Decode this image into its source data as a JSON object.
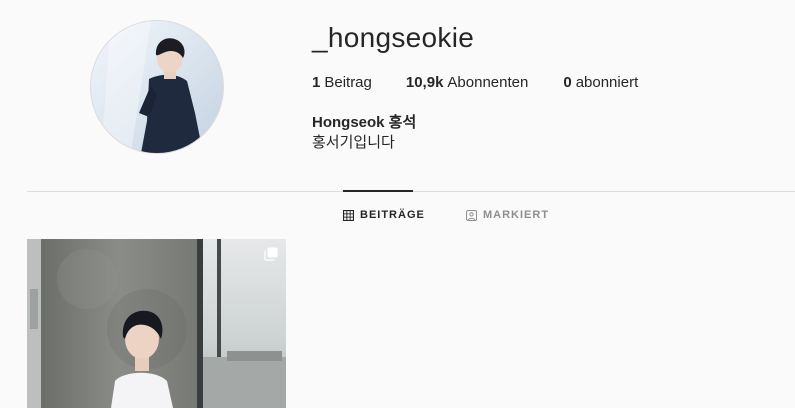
{
  "profile": {
    "username": "_hongseokie",
    "full_name": "Hongseok 홍석",
    "bio": "홍서기입니다"
  },
  "stats": [
    {
      "count": "1",
      "label": "Beitrag"
    },
    {
      "count": "10,9k",
      "label": "Abonnenten"
    },
    {
      "count": "0",
      "label": "abonniert"
    }
  ],
  "tabs": [
    {
      "label": "BEITRÄGE",
      "icon": "grid-icon",
      "active": true
    },
    {
      "label": "MARKIERT",
      "icon": "tagged-person-icon",
      "active": false
    }
  ],
  "posts": [
    {
      "type": "carousel",
      "icon": "multiple-photos-icon"
    }
  ],
  "colors": {
    "background": "#fafafa",
    "text": "#262626",
    "muted": "#8e8e8e",
    "divider": "#dbdbdb"
  }
}
